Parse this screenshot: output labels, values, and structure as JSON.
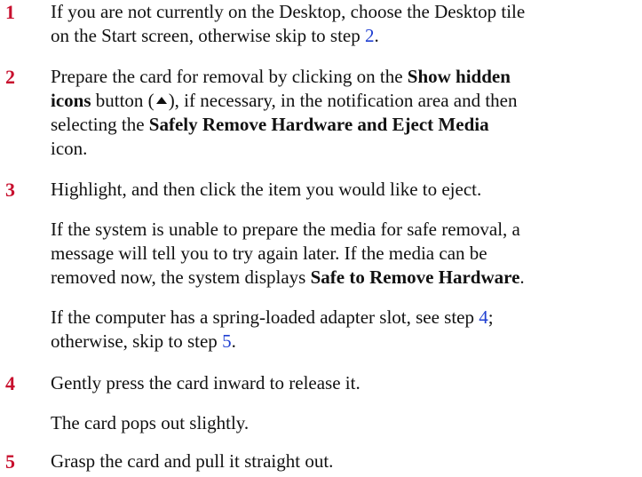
{
  "steps": [
    {
      "number": "1",
      "paragraphs": [
        {
          "line1": "If you are not currently on the Desktop, choose the Desktop tile",
          "line2_pre": "on the Start screen, otherwise skip to step ",
          "line2_link": "2",
          "line2_post": "."
        }
      ]
    },
    {
      "number": "2",
      "paragraphs": [
        {
          "l1_pre": "Prepare the card for removal by clicking on the ",
          "l1_bold": "Show hidden",
          "l2_bold": "icons",
          "l2_mid": " button (",
          "icon": "triangle-up-icon",
          "l2_post": "), if necessary, in the notification area and then",
          "l3_pre": "selecting the ",
          "l3_bold": "Safely Remove Hardware and Eject Media",
          "l4": "icon."
        }
      ]
    },
    {
      "number": "3",
      "paragraphs": [
        {
          "line1": "Highlight, and then click the item you would like to eject."
        },
        {
          "line1": "If the system is unable to prepare the media for safe removal, a",
          "line2": "message will tell you to try again later. If the media can be",
          "line3_pre": "removed now, the system displays ",
          "line3_bold": "Safe to Remove Hardware",
          "line3_post": "."
        },
        {
          "line1_pre": "If the computer has a spring-loaded adapter slot, see step ",
          "line1_link": "4",
          "line1_post": ";",
          "line2_pre": "otherwise, skip to step ",
          "line2_link": "5",
          "line2_post": "."
        }
      ]
    },
    {
      "number": "4",
      "paragraphs": [
        {
          "line1": "Gently press the card inward to release it."
        },
        {
          "line1": "The card pops out slightly."
        }
      ]
    },
    {
      "number": "5",
      "paragraphs": [
        {
          "line1": "Grasp the card and pull it straight out."
        }
      ]
    }
  ]
}
